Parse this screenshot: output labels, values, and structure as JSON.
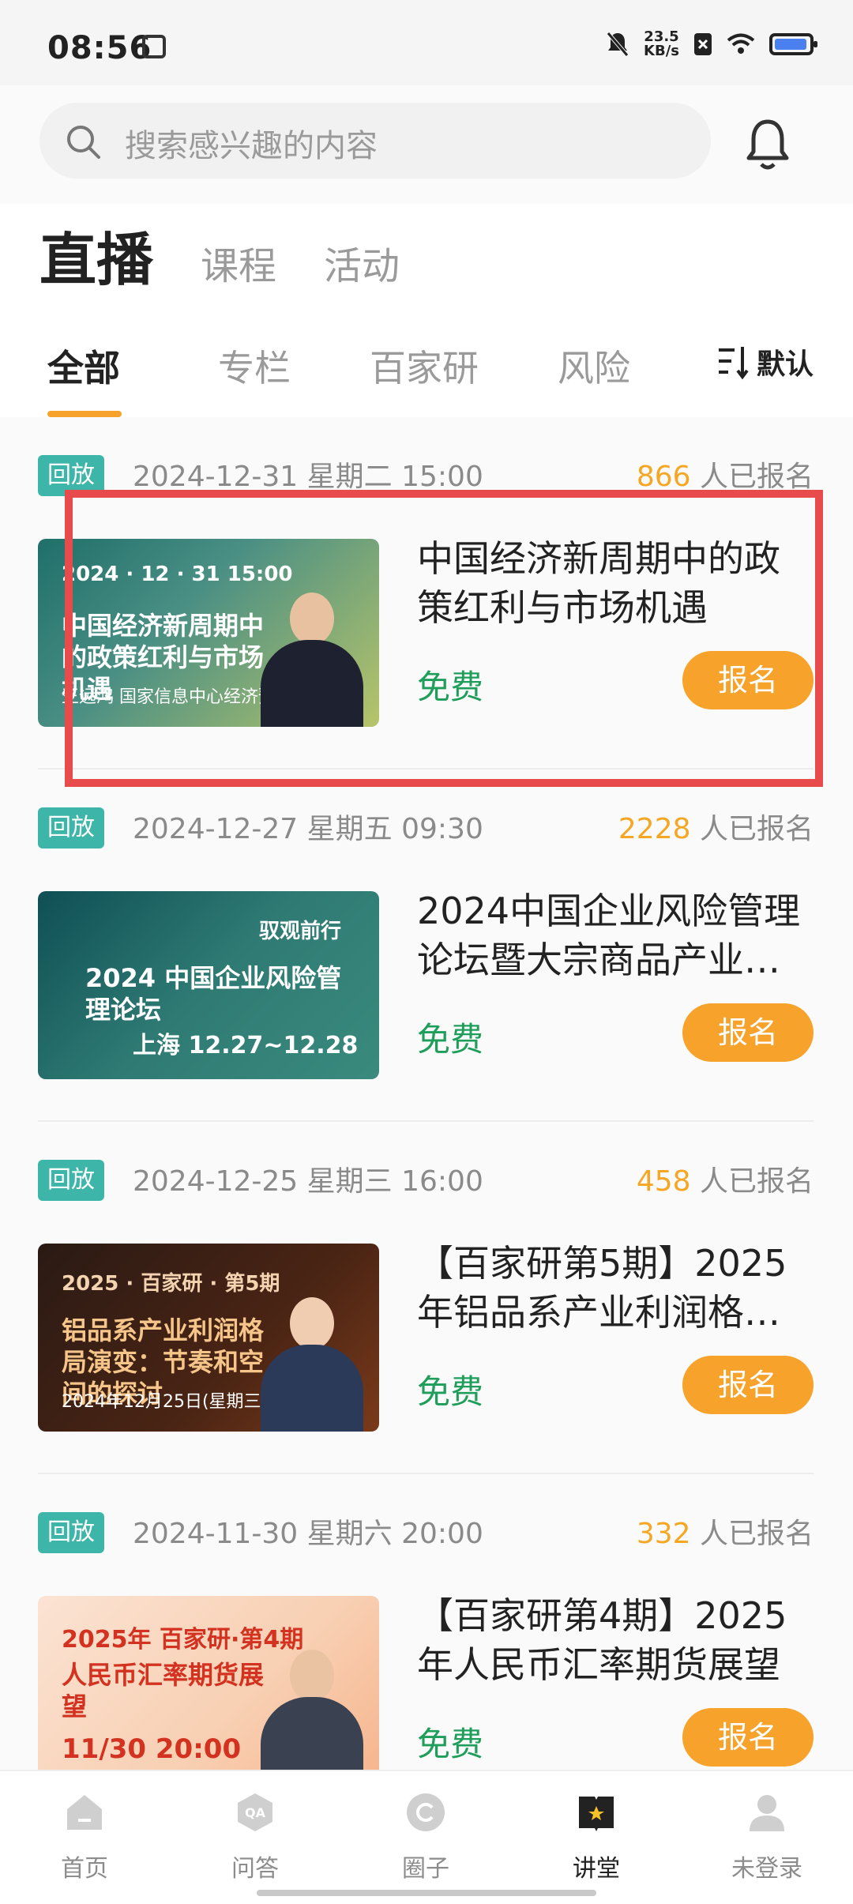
{
  "status": {
    "time": "08:56",
    "net_speed": "23.5",
    "net_unit": "KB/s"
  },
  "search": {
    "placeholder": "搜索感兴趣的内容"
  },
  "top_tabs": [
    "直播",
    "课程",
    "活动"
  ],
  "category_tabs": [
    "全部",
    "专栏",
    "百家研",
    "风险"
  ],
  "sort_label": "默认",
  "signup_suffix": "人已报名",
  "items": [
    {
      "badge": "回放",
      "date": "2024-12-31 星期二 15:00",
      "count": "866",
      "title": "中国经济新周期中的政策红利与市场机遇",
      "price": "免费",
      "button": "报名",
      "thumb": {
        "line1": "2024 · 12 · 31  15:00",
        "line2": "中国经济新周期中的政策红利与市场机遇",
        "line3": "王远鸿 国家信息中心经济预测部"
      },
      "colors": {
        "from": "#1f6f6a",
        "to": "#b7c46a"
      }
    },
    {
      "badge": "回放",
      "date": "2024-12-27 星期五 09:30",
      "count": "2228",
      "title": "2024中国企业风险管理论坛暨大宗商品产业…",
      "price": "免费",
      "button": "报名",
      "thumb": {
        "line1": "驭观前行",
        "line2": "2024 中国企业风险管理论坛",
        "line3": "上海 12.27~12.28"
      },
      "colors": {
        "from": "#0f4f55",
        "to": "#3a8a7d"
      }
    },
    {
      "badge": "回放",
      "date": "2024-12-25 星期三 16:00",
      "count": "458",
      "title": "【百家研第5期】2025年铝品系产业利润格局…",
      "price": "免费",
      "button": "报名",
      "thumb": {
        "line1": "2025 · 百家研 · 第5期",
        "line2": "铝品系产业利润格局演变：节奏和空间的探讨",
        "line3": "2024年12月25日(星期三) 16:00"
      },
      "colors": {
        "from": "#2a1a14",
        "to": "#7a3a1a"
      }
    },
    {
      "badge": "回放",
      "date": "2024-11-30 星期六 20:00",
      "count": "332",
      "title": "【百家研第4期】2025年人民币汇率期货展望",
      "price": "免费",
      "button": "报名",
      "thumb": {
        "line1": "2025年 百家研·第4期",
        "line2": "人民币汇率期货展望",
        "line3": "11/30 20:00"
      },
      "colors": {
        "from": "#fbe3d3",
        "to": "#f6b48d"
      }
    }
  ],
  "bottom_nav": [
    {
      "label": "首页",
      "icon": "home-icon"
    },
    {
      "label": "问答",
      "icon": "qa-icon"
    },
    {
      "label": "圈子",
      "icon": "circle-icon"
    },
    {
      "label": "讲堂",
      "icon": "lecture-icon"
    },
    {
      "label": "未登录",
      "icon": "user-icon"
    }
  ],
  "accent": "#f7a22a",
  "badge_color": "#3db5a8"
}
